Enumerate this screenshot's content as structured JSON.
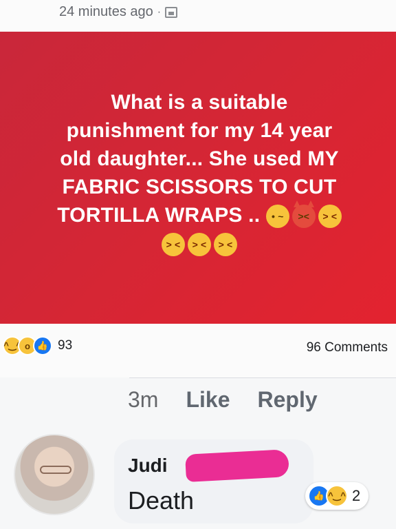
{
  "post": {
    "timestamp": "24 minutes ago",
    "separator": "·",
    "audience_icon": "photo-icon",
    "text_lines": [
      "What is a suitable",
      "punishment for my 14 year",
      "old daughter... She used MY",
      "FABRIC SCISSORS TO CUT",
      "TORTILLA WRAPS .."
    ],
    "emoji_line1": [
      "confused-emoji",
      "devil-emoji",
      "angry-emoji"
    ],
    "emoji_line2": [
      "angry-emoji",
      "angry-emoji",
      "angry-emoji"
    ],
    "background_color": "#d42635"
  },
  "stats": {
    "reactions": [
      "haha",
      "wow",
      "like"
    ],
    "reaction_count": "93",
    "comments_count": "96 Comments"
  },
  "comment_actions": {
    "time": "3m",
    "like": "Like",
    "reply": "Reply"
  },
  "comment": {
    "author": "Judi",
    "text": "Death",
    "reaction_count": "2",
    "reactions": [
      "like",
      "haha"
    ]
  },
  "colors": {
    "like_blue": "#1877f2",
    "redaction_pink": "#ea2d94"
  }
}
